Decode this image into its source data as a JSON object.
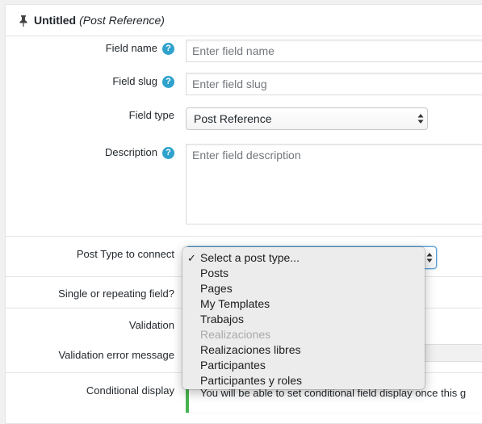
{
  "header": {
    "title": "Untitled",
    "type_label": "(Post Reference)"
  },
  "fields": {
    "field_name": {
      "label": "Field name",
      "placeholder": "Enter field name"
    },
    "field_slug": {
      "label": "Field slug",
      "placeholder": "Enter field slug"
    },
    "field_type": {
      "label": "Field type",
      "value": "Post Reference"
    },
    "description": {
      "label": "Description",
      "placeholder": "Enter field description"
    },
    "post_type": {
      "label": "Post Type to connect"
    },
    "single_repeat": {
      "label": "Single or repeating field?"
    },
    "validation": {
      "label": "Validation"
    },
    "validation_error": {
      "label": "Validation error message"
    },
    "conditional": {
      "label": "Conditional display",
      "notice": "You will be able to set conditional field display once this g"
    }
  },
  "help_icon_glyph": "?",
  "dropdown": {
    "check_glyph": "✓",
    "options": [
      {
        "label": "Select a post type...",
        "selected": true,
        "disabled": false
      },
      {
        "label": "Posts",
        "selected": false,
        "disabled": false
      },
      {
        "label": "Pages",
        "selected": false,
        "disabled": false
      },
      {
        "label": "My Templates",
        "selected": false,
        "disabled": false
      },
      {
        "label": "Trabajos",
        "selected": false,
        "disabled": false
      },
      {
        "label": "Realizaciones",
        "selected": false,
        "disabled": true
      },
      {
        "label": "Realizaciones libres",
        "selected": false,
        "disabled": false
      },
      {
        "label": "Participantes",
        "selected": false,
        "disabled": false
      },
      {
        "label": "Participantes y roles",
        "selected": false,
        "disabled": false
      }
    ]
  },
  "colors": {
    "help_icon": "#2ea2cc",
    "notice_border": "#46b450",
    "focus_ring": "#5b9dd9"
  }
}
